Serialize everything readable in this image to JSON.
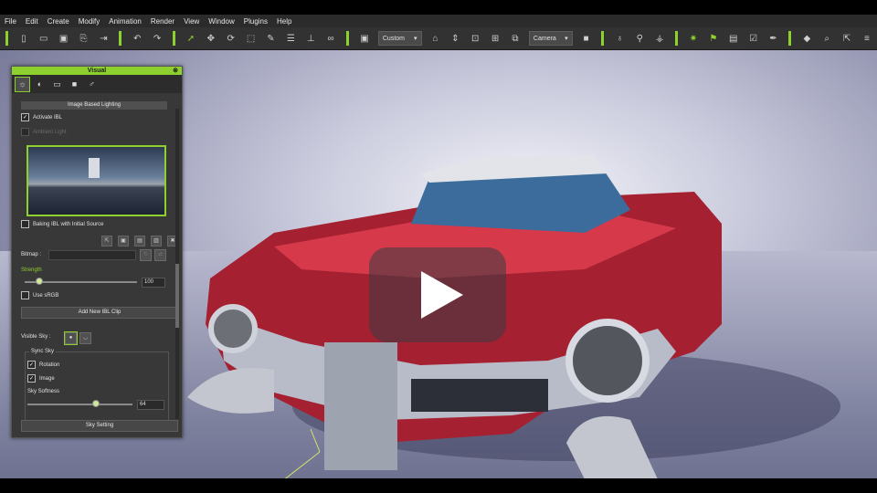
{
  "menu": [
    "File",
    "Edit",
    "Create",
    "Modify",
    "Animation",
    "Render",
    "View",
    "Window",
    "Plugins",
    "Help"
  ],
  "toolbar": {
    "view_mode": "Custom",
    "camera": "Camera"
  },
  "panel": {
    "title": "Visual",
    "section_title": "Image Based Lighting",
    "activate_ibl": "Activate IBL",
    "ambient_light": "Ambient Light",
    "baking_label": "Baking IBL with Initial Source",
    "bitmap_label": "Bitmap :",
    "strength_label": "Strength",
    "strength_value": "100",
    "strength_fraction": 0.12,
    "use_srgb": "Use sRGB",
    "add_clip_button": "Add New IBL Clip",
    "visible_sky_label": "Visible Sky :",
    "sync_sky_label": "Sync Sky",
    "rotation_label": "Rotation",
    "image_label": "Image",
    "sky_softness_label": "Sky Softness",
    "sky_softness_value": "64",
    "sky_softness_fraction": 0.64,
    "sky_setting_button": "Sky Setting",
    "check_mark": "✓"
  },
  "colors": {
    "accent": "#8ed12e",
    "car_red": "#c8273a"
  }
}
